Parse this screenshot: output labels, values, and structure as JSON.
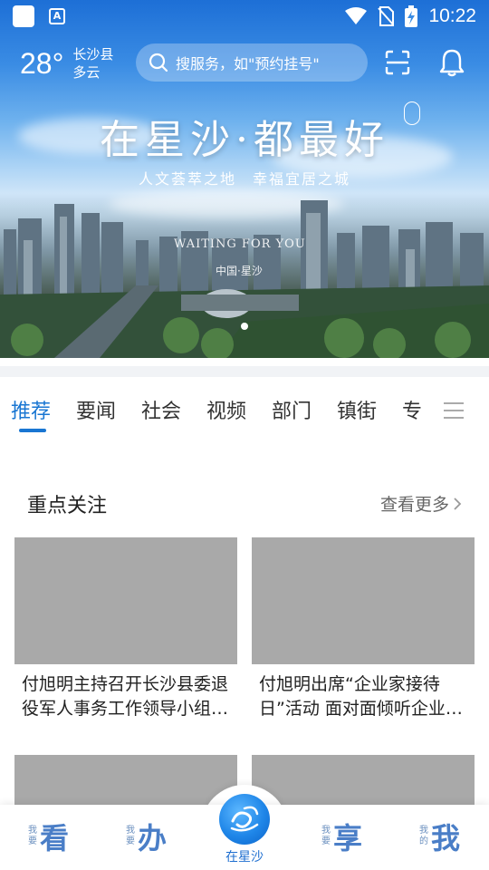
{
  "status_bar": {
    "time": "10:22"
  },
  "header": {
    "temperature": "28°",
    "location": "长沙县",
    "weather": "多云",
    "search_placeholder": "搜服务，如\"预约挂号\""
  },
  "hero": {
    "title": "在星沙·都最好",
    "subtitle": "人文荟萃之地　幸福宜居之城",
    "caption": "WAITING FOR YOU",
    "caption_sub": "中国·星沙"
  },
  "tabs": [
    "推荐",
    "要闻",
    "社会",
    "视频",
    "部门",
    "镇街",
    "专"
  ],
  "section": {
    "title": "重点关注",
    "more_label": "查看更多"
  },
  "cards": [
    {
      "title": "付旭明主持召开长沙县委退役军人事务工作领导小组会议"
    },
    {
      "title": "付旭明出席“企业家接待日”活动 面对面倾听企业心声"
    }
  ],
  "bottom_nav": {
    "items": [
      {
        "small": "我要",
        "big": "看"
      },
      {
        "small": "我要",
        "big": "办"
      },
      {
        "small": "我要",
        "big": "享"
      },
      {
        "small": "我的",
        "big": "我"
      }
    ],
    "center_label": "在星沙"
  },
  "colors": {
    "accent": "#1976d2",
    "placeholder_image": "#a9a9a9"
  }
}
